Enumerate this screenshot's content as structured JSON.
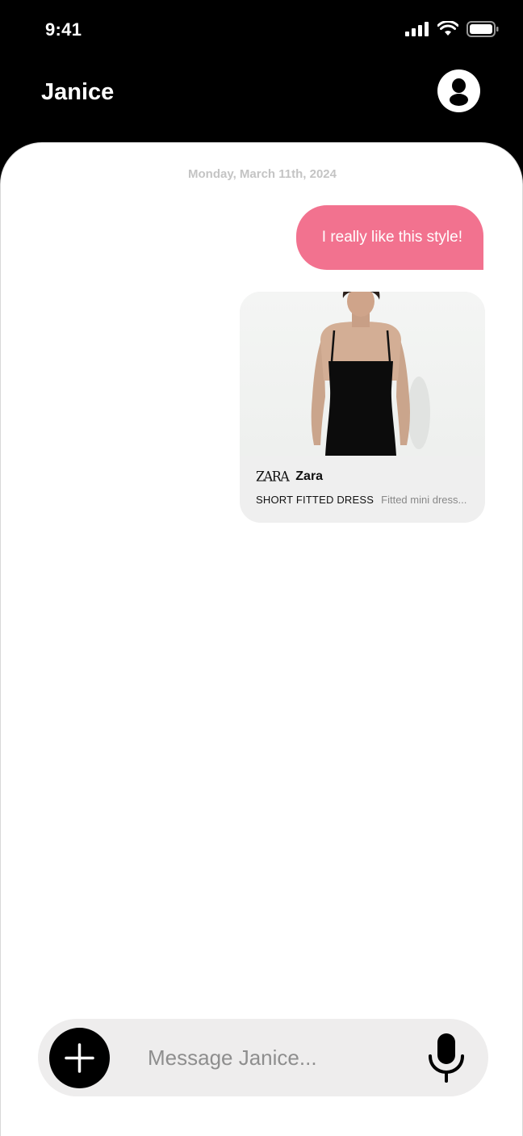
{
  "status_bar": {
    "time": "9:41",
    "icons": [
      "signal-icon",
      "wifi-icon",
      "battery-icon"
    ]
  },
  "header": {
    "title": "Janice",
    "profile_icon": "person-icon"
  },
  "chat": {
    "date": "Monday, March 11th, 2024",
    "messages": [
      {
        "type": "text",
        "direction": "sent",
        "text": "I really like this style!"
      }
    ],
    "product_card": {
      "brand_logo": "ZARA",
      "brand": "Zara",
      "title": "SHORT FITTED DRESS",
      "description": "Fitted mini dress..."
    }
  },
  "composer": {
    "placeholder": "Message Janice...",
    "add_icon": "plus-icon",
    "mic_icon": "microphone-icon"
  },
  "colors": {
    "background": "#000000",
    "panel": "#ffffff",
    "sent_bubble": "#f2728f",
    "card": "#efefef",
    "composer": "#eeeded"
  }
}
